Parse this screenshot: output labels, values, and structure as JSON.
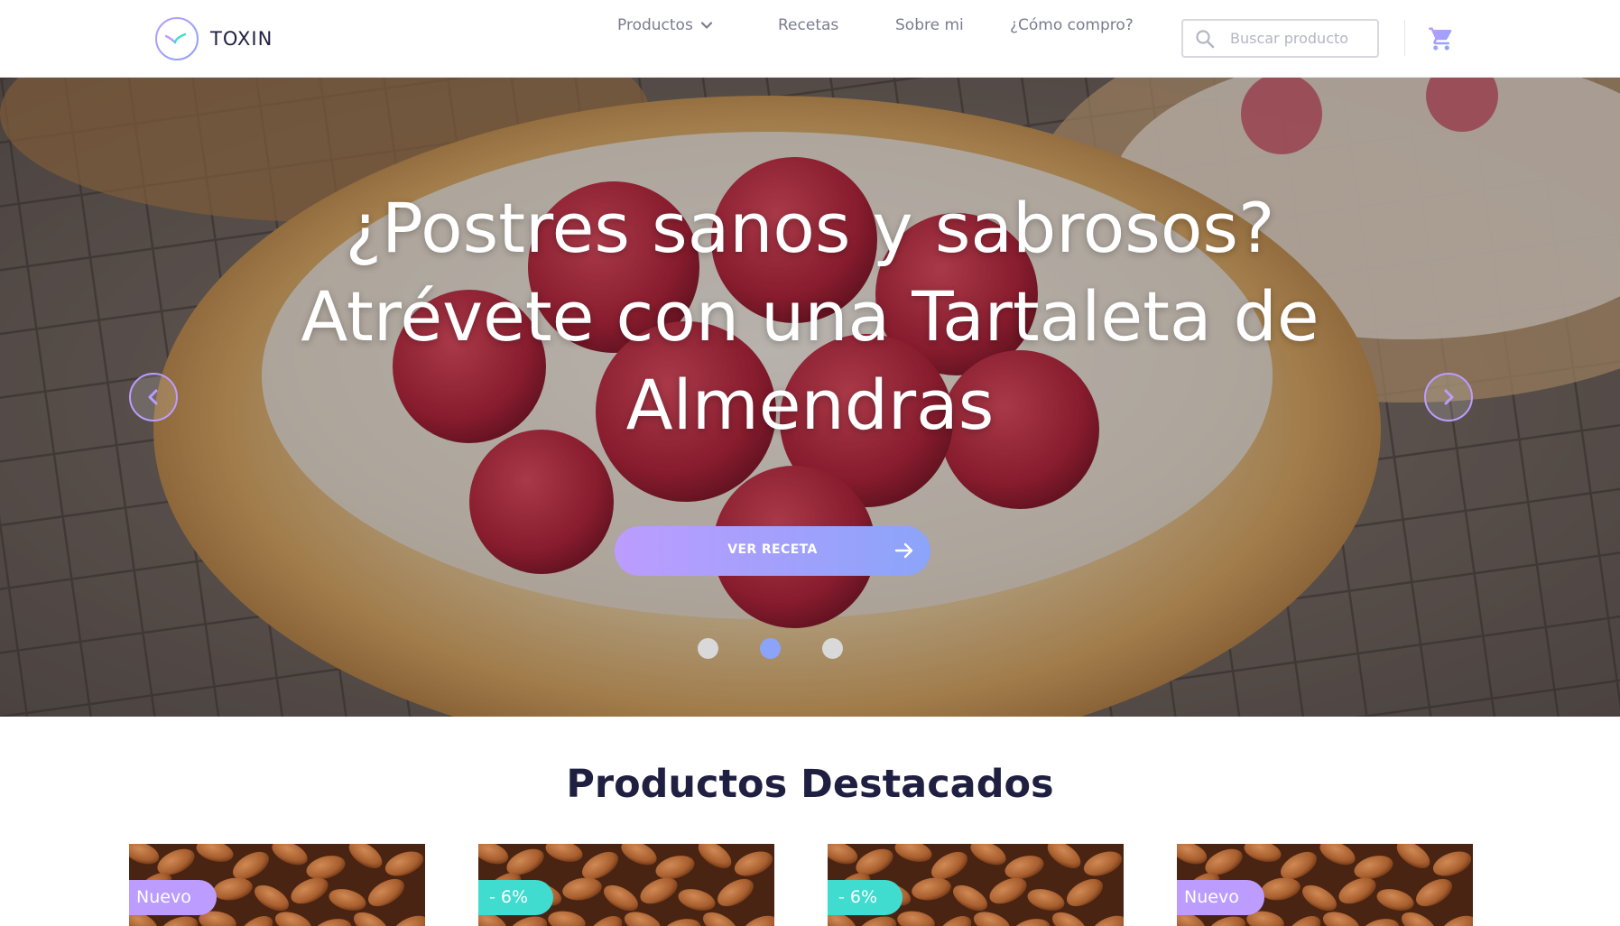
{
  "brand": {
    "name": "TOXIN"
  },
  "nav": {
    "items": [
      {
        "label": "Productos",
        "has_dropdown": true
      },
      {
        "label": "Recetas"
      },
      {
        "label": "Sobre mi"
      },
      {
        "label": "¿Cómo compro?"
      }
    ]
  },
  "search": {
    "placeholder": "Buscar producto",
    "value": ""
  },
  "hero": {
    "title_lines": [
      "¿Postres sanos y sabrosos?",
      "Atrévete con una Tartaleta de",
      "Almendras"
    ],
    "cta_label": "VER RECETA",
    "slides": {
      "count": 3,
      "active_index": 1
    }
  },
  "featured": {
    "title": "Productos Destacados",
    "products": [
      {
        "badge": "Nuevo",
        "badge_type": "new"
      },
      {
        "badge": "- 6%",
        "badge_type": "sale"
      },
      {
        "badge": "- 6%",
        "badge_type": "sale"
      },
      {
        "badge": "Nuevo",
        "badge_type": "new"
      }
    ]
  },
  "colors": {
    "accent_purple": "#bc9cff",
    "accent_blue": "#8ba4f9",
    "accent_green": "#3fdccf",
    "dark_text": "#1f2041",
    "muted_text": "#7b7d90"
  }
}
